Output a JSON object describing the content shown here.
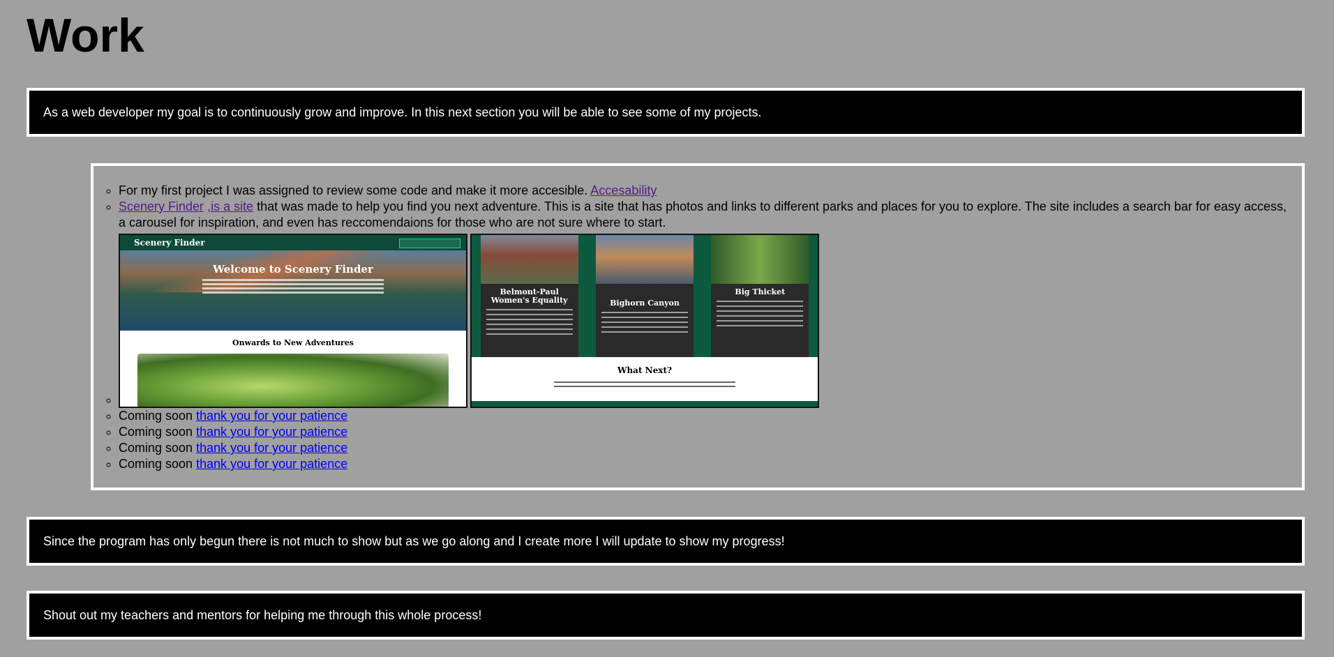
{
  "page": {
    "title": "Work",
    "intro_text": "As a web developer my goal is to continuously grow and improve. In this next section you will be able to see some of my projects."
  },
  "projects": {
    "item1_text": "For my first project I was assigned to review some code and make it more accesible.",
    "item1_link": "Accesability",
    "item2_link1": "Scenery Finder",
    "item2_link2": ",is a site",
    "item2_text": "that was made to help you find you next adventure. This is a site that has photos and links to different parks and places for you to explore. The site includes a search bar for easy access, a carousel for inspiration, and even has reccomendaions for those who are not sure where to start.",
    "coming_soon": [
      {
        "text": "Coming soon",
        "link": "thank you for your patience"
      },
      {
        "text": "Coming soon",
        "link": "thank you for your patience"
      },
      {
        "text": "Coming soon",
        "link": "thank you for your patience"
      },
      {
        "text": "Coming soon",
        "link": "thank you for your patience"
      }
    ]
  },
  "screenshot1": {
    "app_name": "Scenery Finder",
    "heading": "Welcome to Scenery Finder",
    "subheading": "Onwards to New Adventures"
  },
  "screenshot2": {
    "cards": [
      {
        "title": "Belmont-Paul Women's Equality"
      },
      {
        "title": "Bighorn Canyon"
      },
      {
        "title": "Big Thicket"
      }
    ],
    "next_heading": "What Next?"
  },
  "closing_text": "Since the program has only begun there is not much to show but as we go along and I create more I will update to show my progress!",
  "shout_text": "Shout out my teachers and mentors for helping me through this whole process!",
  "colors": {
    "background": "#a0a0a0",
    "box": "#000000",
    "border": "#ffffff",
    "visited_link": "#551a8b",
    "link": "#0000ee"
  }
}
